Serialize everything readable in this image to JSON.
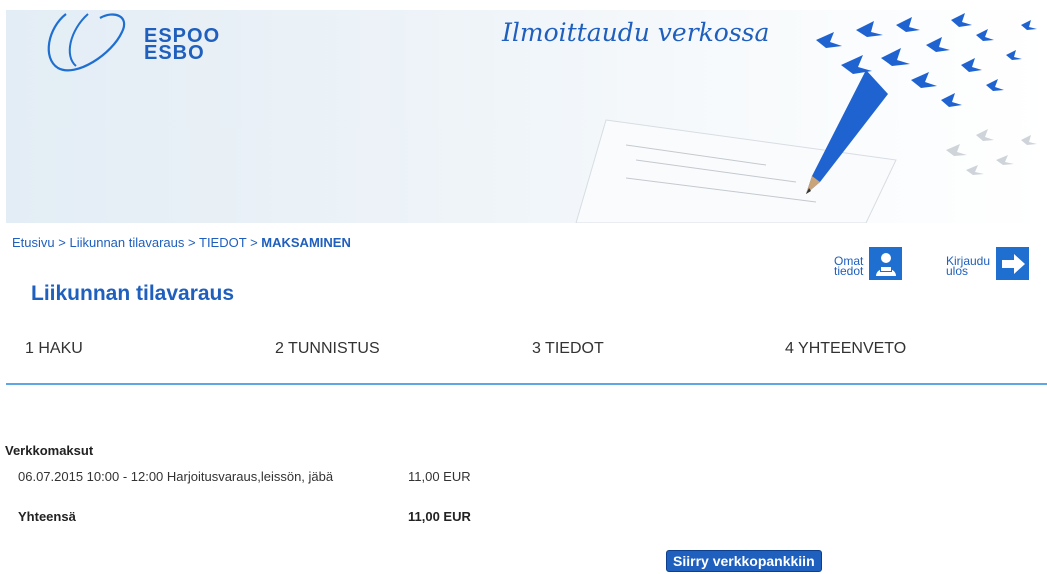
{
  "header": {
    "logo_line1": "ESPOO",
    "logo_line2": "ESBO",
    "banner_title": "Ilmoittaudu verkossa",
    "accent_color": "#1f5fbd"
  },
  "breadcrumb": {
    "items": [
      "Etusivu",
      "Liikunnan tilavaraus",
      "TIEDOT"
    ],
    "separator": ">",
    "current": "MAKSAMINEN"
  },
  "user_links": {
    "profile_line1": "Omat",
    "profile_line2": "tiedot",
    "profile_icon": "person-icon",
    "logout_line1": "Kirjaudu",
    "logout_line2": "ulos",
    "logout_icon": "arrow-right-icon"
  },
  "page_title": "Liikunnan tilavaraus",
  "steps": [
    "1 HAKU",
    "2 TUNNISTUS",
    "3 TIEDOT",
    "4 YHTEENVETO"
  ],
  "payments": {
    "heading": "Verkkomaksut",
    "items": [
      {
        "description": "06.07.2015 10:00 - 12:00 Harjoitusvaraus,leissön, jäbä",
        "amount": "11,00 EUR"
      }
    ],
    "total_label": "Yhteensä",
    "total_amount": "11,00 EUR",
    "button_label": "Siirry verkkopankkiin"
  }
}
